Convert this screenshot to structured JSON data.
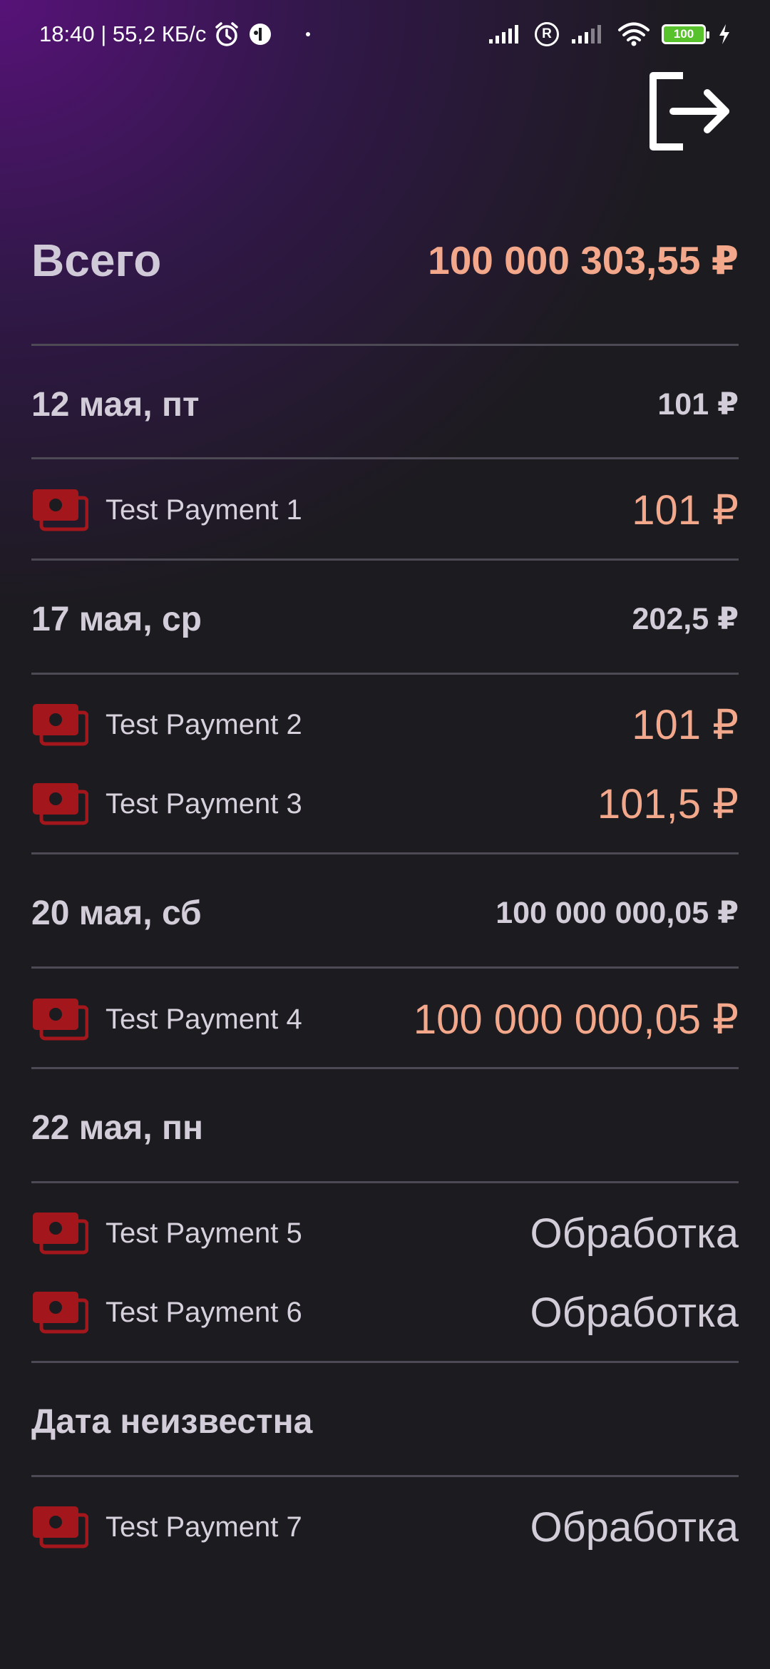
{
  "status_bar": {
    "left_text": "18:40 | 55,2 КБ/с",
    "battery": "100",
    "roaming": "R",
    "icons": [
      "alarm-icon",
      "app-notification-icon",
      "signal-icon",
      "roaming-icon",
      "signal-icon",
      "wifi-icon",
      "battery-icon",
      "charging-icon"
    ]
  },
  "header": {
    "logout_icon": "logout-icon"
  },
  "summary": {
    "total_label": "Всего",
    "total_value": "100 000 303,55 ₽"
  },
  "groups": [
    {
      "date": "12 мая, пт",
      "sum": "101 ₽",
      "payments": [
        {
          "name": "Test Payment 1",
          "amount": "101 ₽"
        }
      ]
    },
    {
      "date": "17 мая, ср",
      "sum": "202,5 ₽",
      "payments": [
        {
          "name": "Test Payment 2",
          "amount": "101 ₽"
        },
        {
          "name": "Test Payment 3",
          "amount": "101,5 ₽"
        }
      ]
    },
    {
      "date": "20 мая, сб",
      "sum": "100 000 000,05 ₽",
      "payments": [
        {
          "name": "Test Payment 4",
          "amount": "100 000 000,05 ₽"
        }
      ]
    },
    {
      "date": "22 мая, пн",
      "sum": "",
      "payments": [
        {
          "name": "Test Payment 5",
          "status": "Обработка"
        },
        {
          "name": "Test Payment 6",
          "status": "Обработка"
        }
      ]
    },
    {
      "date": "Дата неизвестна",
      "sum": "",
      "payments": [
        {
          "name": "Test Payment 7",
          "status": "Обработка"
        }
      ]
    }
  ],
  "colors": {
    "accent_amount": "#f4a88b",
    "icon_red": "#a3161b",
    "background": "#1c1b1f",
    "gradient_purple": "#5a127d"
  }
}
